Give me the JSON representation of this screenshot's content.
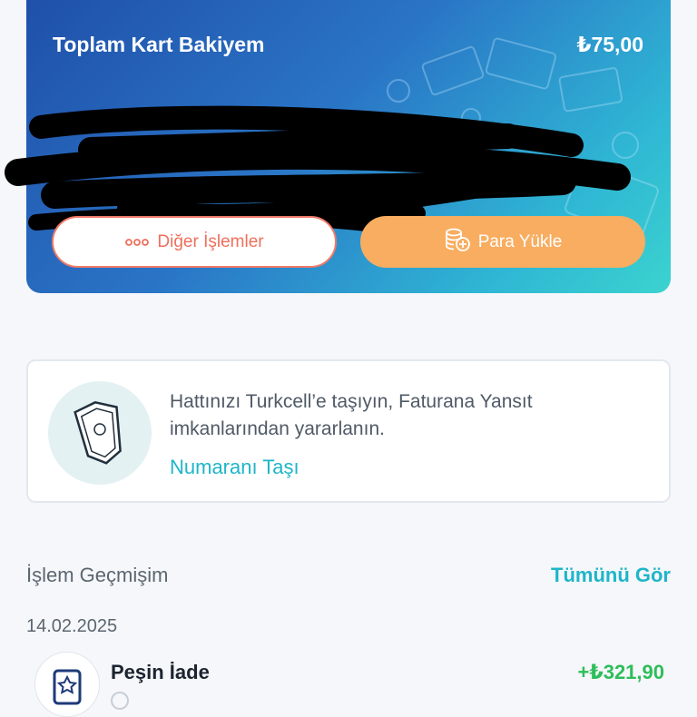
{
  "card": {
    "balance_label": "Toplam Kart Bakiyem",
    "balance_value": "₺75,00",
    "other_button": "Diğer İşlemler",
    "load_button": "Para Yükle",
    "colors": {
      "gradient_start": "#1f4fa8",
      "gradient_end": "#3bd3cf",
      "load_button": "#f8ad60",
      "other_button_text": "#ef6f5c"
    }
  },
  "info_card": {
    "text": "Hattınızı Turkcell’e taşıyın, Faturana Yansıt imkanlarından yararlanın.",
    "link": "Numaranı Taşı",
    "icon": "shield-icon"
  },
  "history": {
    "title": "İşlem Geçmişim",
    "see_all": "Tümünü Gör",
    "date": "14.02.2025",
    "transactions": [
      {
        "title": "Peşin İade",
        "amount": "+₺321,90",
        "icon": "star-badge-icon"
      }
    ]
  }
}
